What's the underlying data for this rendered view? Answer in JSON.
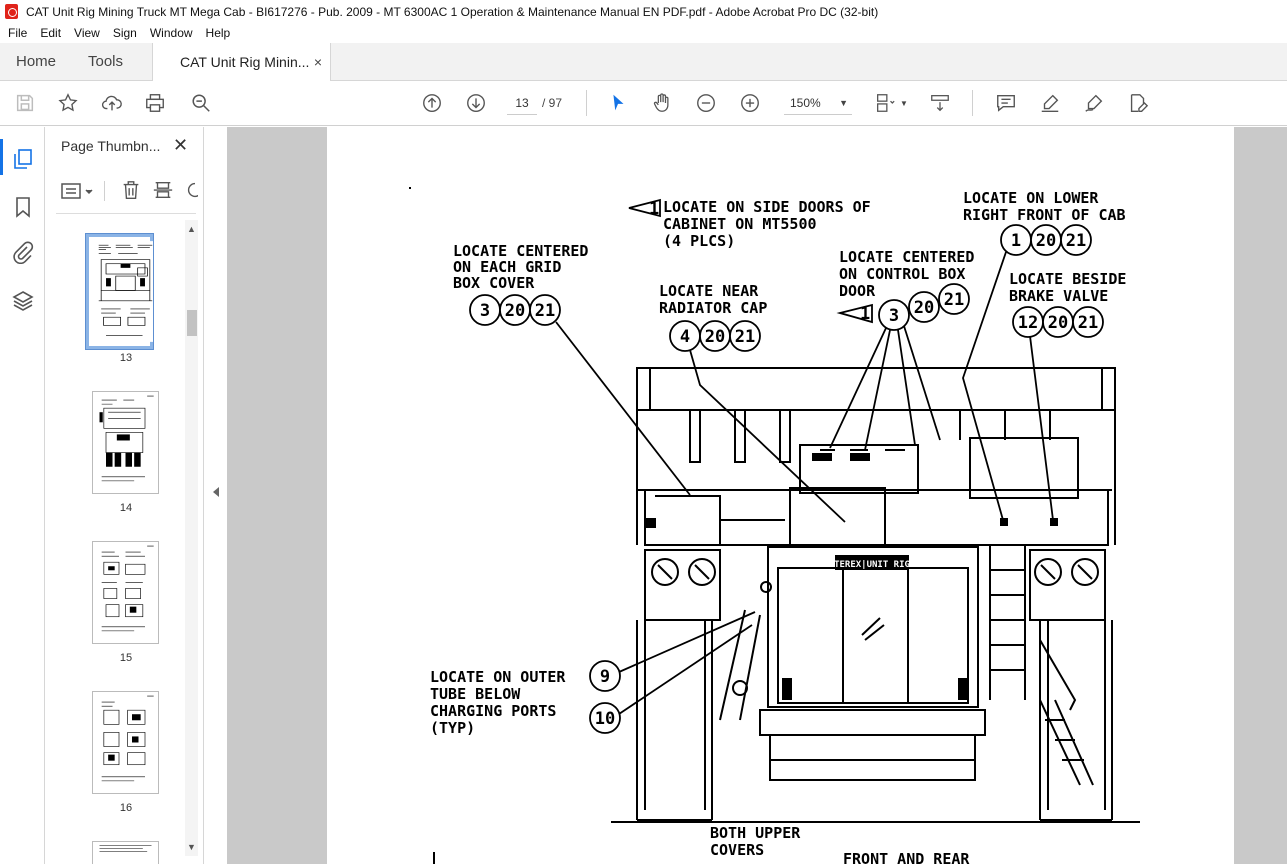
{
  "window": {
    "title": "CAT Unit Rig Mining Truck MT Mega Cab - BI617276 - Pub. 2009 - MT 6300AC 1 Operation & Maintenance Manual EN PDF.pdf - Adobe Acrobat Pro DC (32-bit)"
  },
  "menu": [
    "File",
    "Edit",
    "View",
    "Sign",
    "Window",
    "Help"
  ],
  "tabs": {
    "home": "Home",
    "tools": "Tools",
    "document": "CAT Unit Rig Minin...",
    "close": "×"
  },
  "toolbar": {
    "current_page": "13",
    "total_pages": "/ 97",
    "zoom": "150%",
    "icons": [
      "save-icon",
      "star-icon",
      "upload-icon",
      "print-icon",
      "search-zoom-icon",
      "page-up-icon",
      "page-down-icon",
      "select-cursor-icon",
      "hand-icon",
      "zoom-out-icon",
      "zoom-in-icon",
      "page-layout-icon",
      "scroll-mode-icon",
      "comment-icon",
      "highlight-icon",
      "sign-icon",
      "edit-pdf-icon"
    ]
  },
  "sidebar": {
    "panel_title": "Page Thumbn...",
    "thumbnails": [
      {
        "label": "13",
        "selected": true
      },
      {
        "label": "14",
        "selected": false
      },
      {
        "label": "15",
        "selected": false
      },
      {
        "label": "16",
        "selected": false
      }
    ]
  },
  "drawing": {
    "labels": {
      "side_doors_1": "LOCATE ON SIDE DOORS OF",
      "side_doors_2": "CABINET ON MT5500",
      "side_doors_3": "(4 PLCS)",
      "lower_cab_1": "LOCATE ON LOWER",
      "lower_cab_2": "RIGHT FRONT OF CAB",
      "grid_box_1": "LOCATE CENTERED",
      "grid_box_2": "ON EACH GRID",
      "grid_box_3": "BOX COVER",
      "control_box_1": "LOCATE CENTERED",
      "control_box_2": "ON CONTROL BOX",
      "control_box_3": "DOOR",
      "brake_1": "LOCATE BESIDE",
      "brake_2": "BRAKE VALVE",
      "radiator_1": "LOCATE NEAR",
      "radiator_2": "RADIATOR CAP",
      "outer_tube_1": "LOCATE ON OUTER",
      "outer_tube_2": "TUBE BELOW",
      "outer_tube_3": "CHARGING PORTS",
      "outer_tube_4": "(TYP)",
      "upper_covers_1": "BOTH UPPER",
      "upper_covers_2": "COVERS",
      "front_rear": "FRONT AND REAR",
      "nameplate": "TEREX|UNIT RIG"
    },
    "bubbles": {
      "flag_a": "1",
      "flag_b": "1",
      "lower_cab": [
        "1",
        "20",
        "21"
      ],
      "grid_box": [
        "3",
        "20",
        "21"
      ],
      "control_box": [
        "3",
        "20",
        "21"
      ],
      "brake": [
        "12",
        "20",
        "21"
      ],
      "radiator": [
        "4",
        "20",
        "21"
      ],
      "tube_a": "9",
      "tube_b": "10"
    }
  }
}
